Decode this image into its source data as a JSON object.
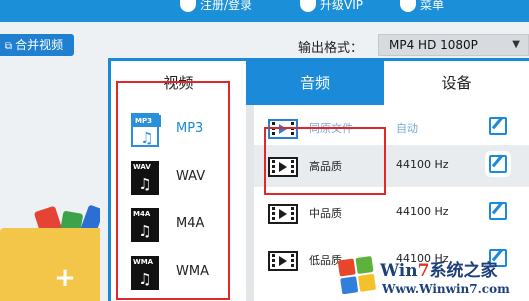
{
  "top_bar": {
    "links": [
      "注册/登录",
      "升级VIP",
      "菜单"
    ]
  },
  "toolbar": {
    "merge_button_label": "合并视频",
    "output_format_label": "输出格式：",
    "output_format_value": "MP4  HD 1080P"
  },
  "tabs": [
    {
      "label": "视频",
      "active": false
    },
    {
      "label": "音频",
      "active": true
    },
    {
      "label": "设备",
      "active": false
    }
  ],
  "formats": [
    {
      "label": "MP3",
      "tag": "MP3",
      "active": true
    },
    {
      "label": "WAV",
      "tag": "WAV",
      "active": false
    },
    {
      "label": "M4A",
      "tag": "M4A",
      "active": false
    },
    {
      "label": "WMA",
      "tag": "WMA",
      "active": false
    }
  ],
  "qualities": [
    {
      "name": "同原文件",
      "rate": "自动",
      "selected": false
    },
    {
      "name": "高品质",
      "rate": "44100 Hz",
      "selected": true
    },
    {
      "name": "中品质",
      "rate": "44100 Hz",
      "selected": false
    },
    {
      "name": "低品质",
      "rate": "44100 Hz",
      "selected": false
    }
  ],
  "watermark": {
    "brand_prefix": "Win",
    "brand_seven": "7",
    "brand_suffix": "系统之家",
    "url": "Www.Winwin7.com"
  },
  "colors": {
    "accent": "#1b8ad8",
    "highlight": "#e0282a"
  }
}
